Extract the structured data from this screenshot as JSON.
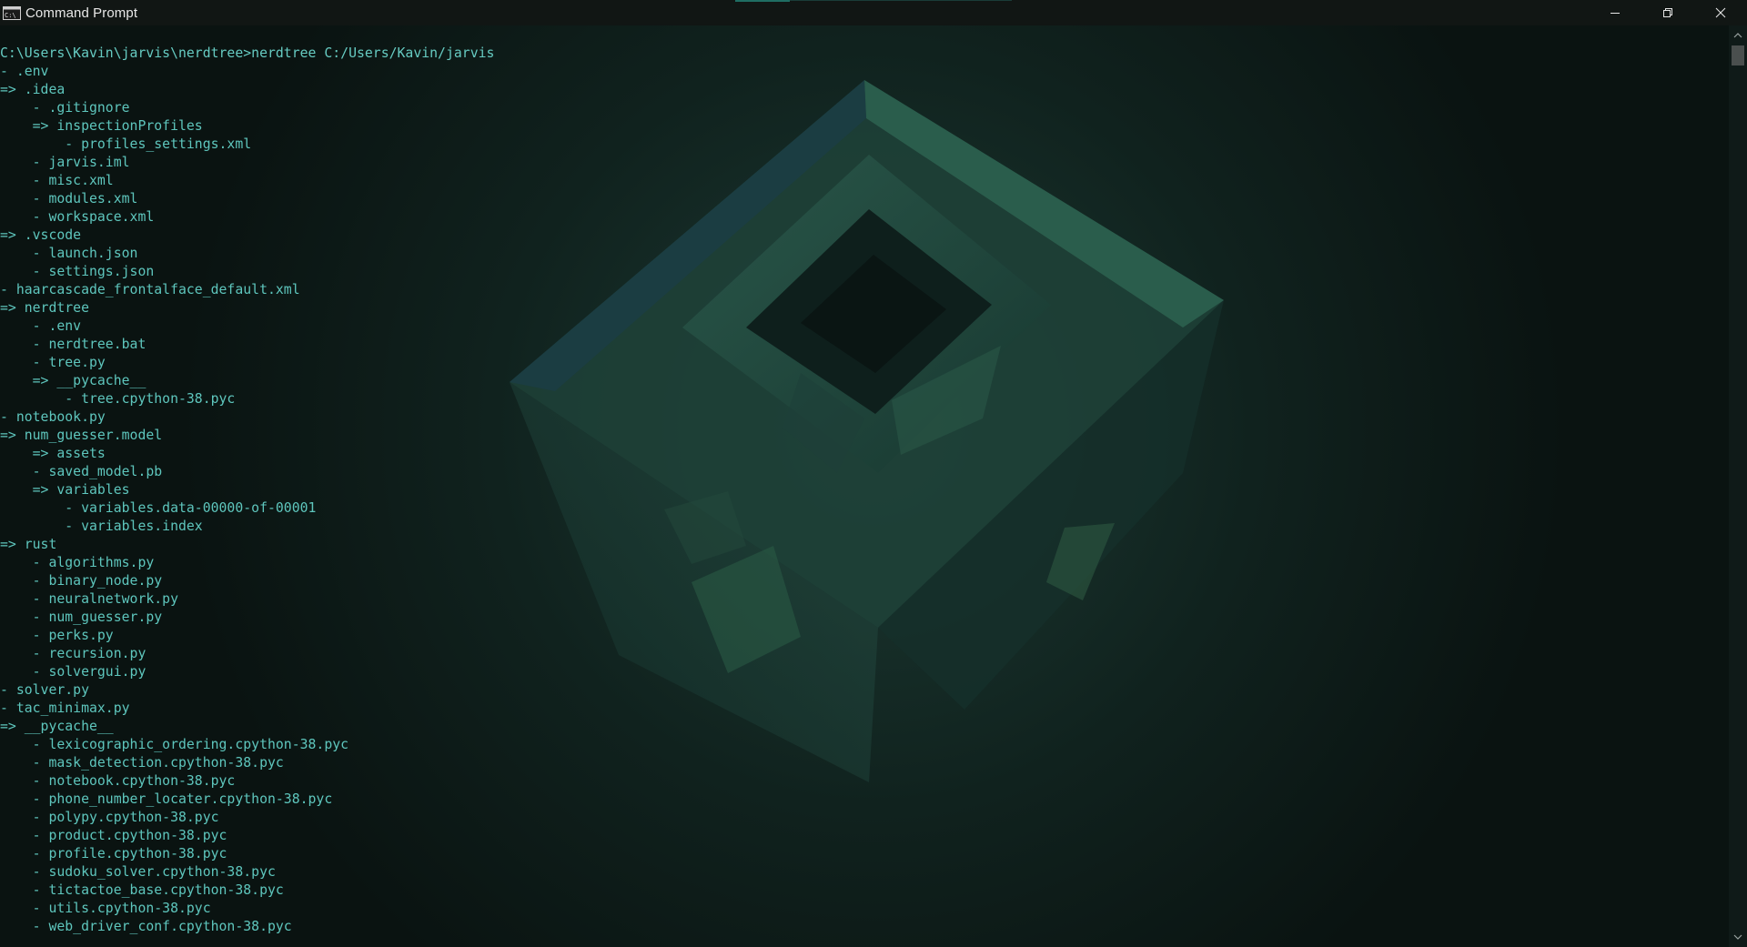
{
  "window": {
    "title": "Command Prompt"
  },
  "terminal": {
    "lines": [
      "C:\\Users\\Kavin\\jarvis\\nerdtree>nerdtree C:/Users/Kavin/jarvis",
      "- .env",
      "=> .idea",
      "    - .gitignore",
      "    => inspectionProfiles",
      "        - profiles_settings.xml",
      "    - jarvis.iml",
      "    - misc.xml",
      "    - modules.xml",
      "    - workspace.xml",
      "=> .vscode",
      "    - launch.json",
      "    - settings.json",
      "- haarcascade_frontalface_default.xml",
      "=> nerdtree",
      "    - .env",
      "    - nerdtree.bat",
      "    - tree.py",
      "    => __pycache__",
      "        - tree.cpython-38.pyc",
      "- notebook.py",
      "=> num_guesser.model",
      "    => assets",
      "    - saved_model.pb",
      "    => variables",
      "        - variables.data-00000-of-00001",
      "        - variables.index",
      "=> rust",
      "    - algorithms.py",
      "    - binary_node.py",
      "    - neuralnetwork.py",
      "    - num_guesser.py",
      "    - perks.py",
      "    - recursion.py",
      "    - solvergui.py",
      "- solver.py",
      "- tac_minimax.py",
      "=> __pycache__",
      "    - lexicographic_ordering.cpython-38.pyc",
      "    - mask_detection.cpython-38.pyc",
      "    - notebook.cpython-38.pyc",
      "    - phone_number_locater.cpython-38.pyc",
      "    - polypy.cpython-38.pyc",
      "    - product.cpython-38.pyc",
      "    - profile.cpython-38.pyc",
      "    - sudoku_solver.cpython-38.pyc",
      "    - tictactoe_base.cpython-38.pyc",
      "    - utils.cpython-38.pyc",
      "    - web_driver_conf.cpython-38.pyc"
    ]
  },
  "icons": {
    "app": "cmd-icon",
    "minimize": "minimize-icon",
    "maximize": "restore-icon",
    "close": "close-icon",
    "scroll_up": "chevron-up-icon",
    "scroll_down": "chevron-down-icon"
  },
  "colors": {
    "text": "#5ec6bd",
    "background": "#0c1614",
    "titlebar": "#111614",
    "accent": "#1f6d63"
  }
}
